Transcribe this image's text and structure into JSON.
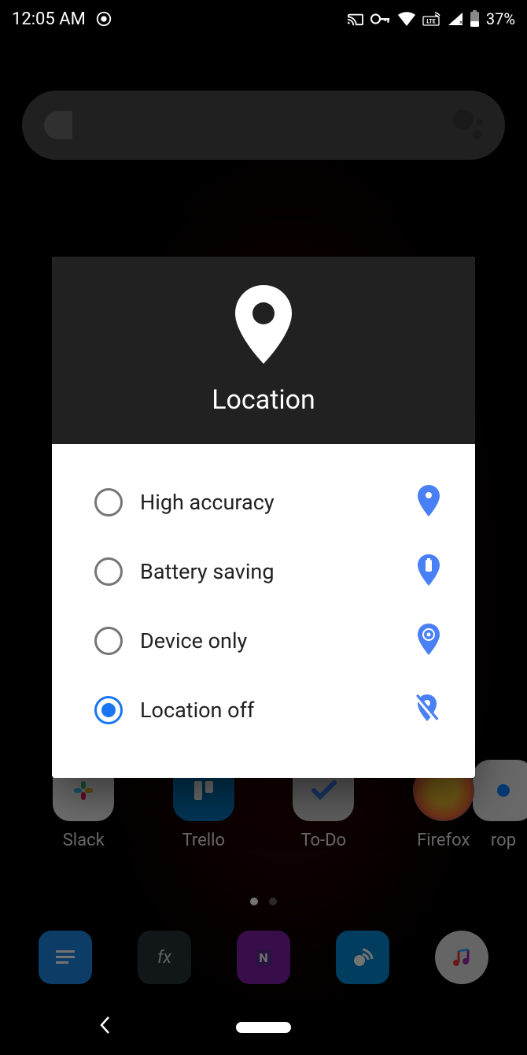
{
  "status": {
    "time": "12:05 AM",
    "battery": "37%"
  },
  "dialog": {
    "title": "Location",
    "options": [
      {
        "label": "High accuracy",
        "selected": false
      },
      {
        "label": "Battery saving",
        "selected": false
      },
      {
        "label": "Device only",
        "selected": false
      },
      {
        "label": "Location off",
        "selected": true
      }
    ]
  },
  "apps": {
    "row": [
      {
        "label": "Slack"
      },
      {
        "label": "Trello"
      },
      {
        "label": "To-Do"
      },
      {
        "label": "Firefox"
      }
    ],
    "partial": {
      "label": "rop"
    }
  }
}
